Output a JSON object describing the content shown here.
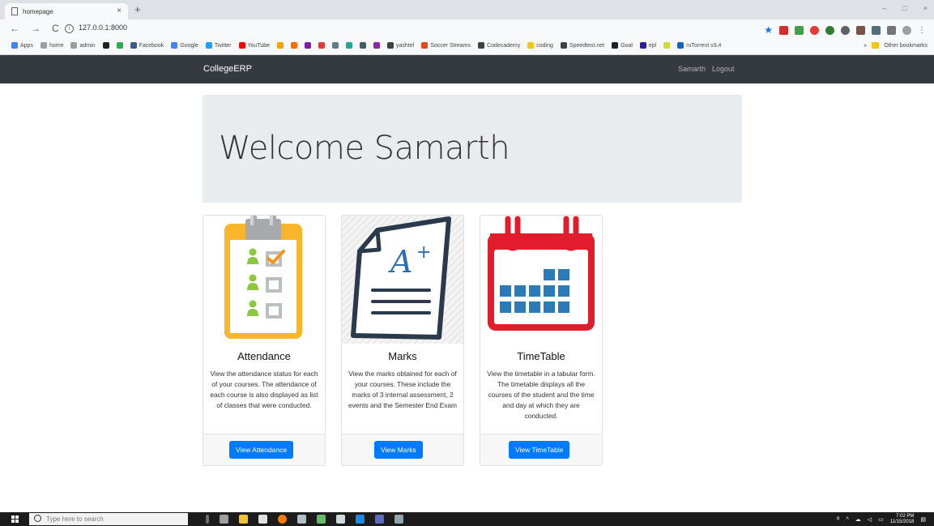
{
  "browser": {
    "tab_title": "homepage",
    "tab_close": "×",
    "new_tab": "+",
    "url": "127.0.0.1:8000",
    "info_glyph": "i",
    "window_controls": [
      "–",
      "□",
      "×"
    ],
    "bookmarks": [
      {
        "label": "Apps",
        "color": "#4285f4"
      },
      {
        "label": "home",
        "color": "#9e9e9e"
      },
      {
        "label": "admin",
        "color": "#9e9e9e"
      },
      {
        "label": "",
        "color": "#222222"
      },
      {
        "label": "",
        "color": "#34a853"
      },
      {
        "label": "Facebook",
        "color": "#3b5998"
      },
      {
        "label": "Google",
        "color": "#4285f4"
      },
      {
        "label": "Twitter",
        "color": "#1da1f2"
      },
      {
        "label": "YouTube",
        "color": "#ff0000"
      },
      {
        "label": "",
        "color": "#f4a400"
      },
      {
        "label": "",
        "color": "#ff6d00"
      },
      {
        "label": "",
        "color": "#7b1fa2"
      },
      {
        "label": "",
        "color": "#e53935"
      },
      {
        "label": "",
        "color": "#607d8b"
      },
      {
        "label": "",
        "color": "#26a69a"
      },
      {
        "label": "",
        "color": "#455a64"
      },
      {
        "label": "",
        "color": "#8e24aa"
      },
      {
        "label": "yashtel",
        "color": "#424242"
      },
      {
        "label": "Soccer Streams",
        "color": "#e64a19"
      },
      {
        "label": "Codecademy",
        "color": "#424242"
      },
      {
        "label": "coding",
        "color": "#f5c518"
      },
      {
        "label": "Speedtest.net",
        "color": "#424242"
      },
      {
        "label": "Goal",
        "color": "#212121"
      },
      {
        "label": "epl",
        "color": "#311b92"
      },
      {
        "label": "",
        "color": "#cddc39"
      },
      {
        "label": "ruTorrent v3.4",
        "color": "#1565c0"
      }
    ],
    "other_bookmarks": "Other bookmarks",
    "overflow": "»"
  },
  "navbar": {
    "brand": "CollegeERP",
    "user": "Samarth",
    "logout": "Logout"
  },
  "jumbotron": {
    "heading": "Welcome Samarth"
  },
  "cards": [
    {
      "title": "Attendance",
      "text": "View the attendance status for each of your courses. The attendance of each course is also displayed as list of classes that were conducted.",
      "button": "View Attendance"
    },
    {
      "title": "Marks",
      "text": "View the marks obtained for each of your courses. These include the marks of 3 internal assessment, 2 events and the Semester End Exam",
      "button": "View Marks"
    },
    {
      "title": "TimeTable",
      "text": "View the timetable in a tabular form. The timetable displays all the courses of the student and the time and day at which they are conducted.",
      "button": "View TimeTable"
    }
  ],
  "taskbar": {
    "search_placeholder": "Type here to search",
    "time": "7:02 PM",
    "date": "11/15/2018"
  },
  "colors": {
    "primary": "#007bff",
    "navbar": "#343a40",
    "jumbotron": "#e9ecef"
  }
}
